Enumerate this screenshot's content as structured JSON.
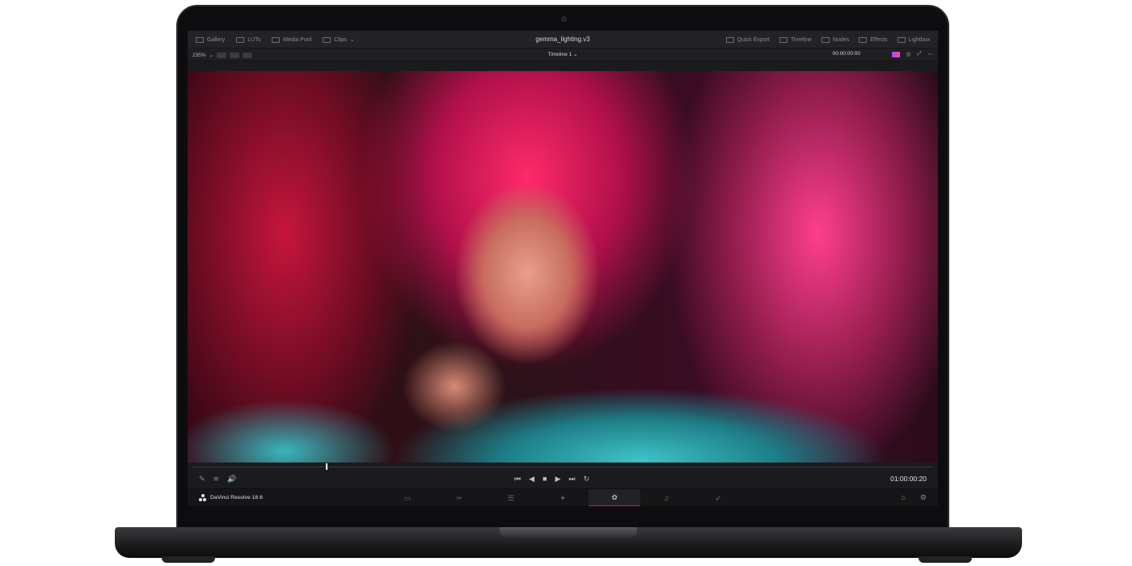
{
  "app": {
    "name": "DaVinci Resolve 18.6",
    "project_title": "gemma_lighting.v3"
  },
  "topbar": {
    "left_items": [
      {
        "label": "Gallery",
        "icon": "gallery-icon"
      },
      {
        "label": "LUTs",
        "icon": "luts-icon"
      },
      {
        "label": "Media Pool",
        "icon": "media-pool-icon"
      },
      {
        "label": "Clips",
        "icon": "clips-icon"
      }
    ],
    "right_items": [
      {
        "label": "Quick Export",
        "icon": "quick-export-icon"
      },
      {
        "label": "Timeline",
        "icon": "timeline-icon"
      },
      {
        "label": "Nodes",
        "icon": "nodes-icon"
      },
      {
        "label": "Effects",
        "icon": "effects-icon"
      },
      {
        "label": "Lightbox",
        "icon": "lightbox-icon"
      }
    ]
  },
  "viewer_bar": {
    "zoom": "235%",
    "timeline_name": "Timeline 1",
    "timecode": "00:00:00:00"
  },
  "transport": {
    "timecode": "01:00:00:20",
    "playhead_fraction": 0.18
  },
  "page_tabs": [
    {
      "name": "media",
      "icon": "media-page-icon",
      "active": false
    },
    {
      "name": "cut",
      "icon": "cut-page-icon",
      "active": false
    },
    {
      "name": "edit",
      "icon": "edit-page-icon",
      "active": false
    },
    {
      "name": "fusion",
      "icon": "fusion-page-icon",
      "active": false
    },
    {
      "name": "color",
      "icon": "color-page-icon",
      "active": true
    },
    {
      "name": "fairlight",
      "icon": "fairlight-page-icon",
      "active": false
    },
    {
      "name": "deliver",
      "icon": "deliver-page-icon",
      "active": false
    }
  ],
  "colors": {
    "active_accent": "#d0213a",
    "panel": "#232327",
    "text": "#d8d8dc"
  }
}
